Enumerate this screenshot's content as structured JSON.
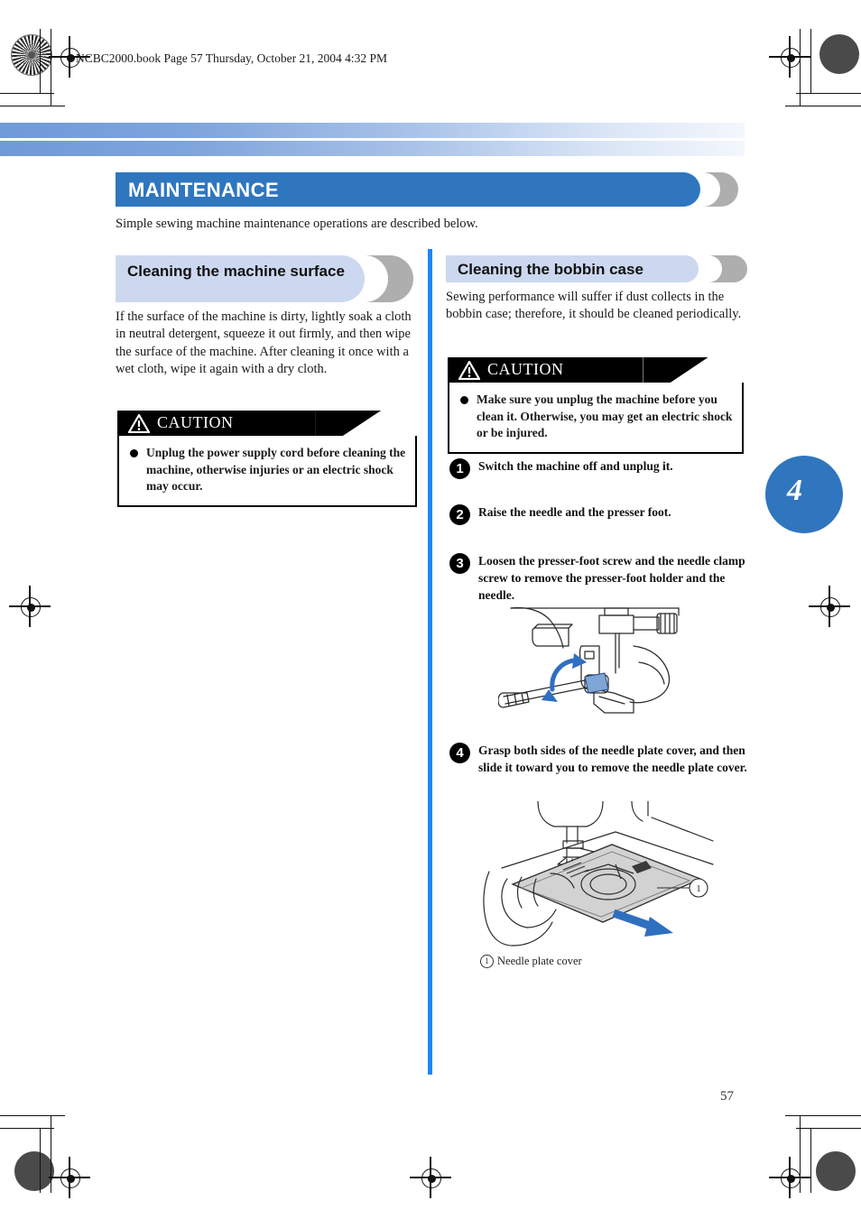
{
  "document": {
    "running_head": "NCBC2000.book  Page 57  Thursday, October 21, 2004  4:32 PM",
    "page_number": "57",
    "chapter_tab": "4"
  },
  "banner": {
    "title": "MAINTENANCE",
    "intro": "Simple sewing machine maintenance operations are described below."
  },
  "left_column": {
    "heading": "Cleaning the machine surface",
    "body": "If the surface of the machine is dirty, lightly soak a cloth in neutral detergent, squeeze it out firmly, and then wipe the surface of the machine. After cleaning it once with a wet cloth, wipe it again with a dry cloth.",
    "caution": {
      "label": "CAUTION",
      "icon": "warning-triangle-icon",
      "items": [
        "Unplug the power supply cord before cleaning the machine, otherwise injuries or an electric shock may occur."
      ]
    }
  },
  "right_column": {
    "heading": "Cleaning the bobbin case",
    "body": "Sewing performance will suffer if dust collects in the bobbin case; therefore, it should be cleaned periodically.",
    "caution": {
      "label": "CAUTION",
      "icon": "warning-triangle-icon",
      "items": [
        "Make sure you unplug the machine before you clean it. Otherwise, you may get an electric shock or be injured."
      ]
    },
    "steps": [
      {
        "number": "1",
        "text": "Switch the machine off and unplug it."
      },
      {
        "number": "2",
        "text": "Raise the needle and the presser foot."
      },
      {
        "number": "3",
        "text": "Loosen the presser-foot screw and the needle clamp screw to remove the presser-foot holder and the needle."
      },
      {
        "number": "4",
        "text": "Grasp both sides of the needle plate cover, and then slide it toward you to remove the needle plate cover."
      }
    ],
    "figures": [
      {
        "name": "presser-foot-screw-illustration",
        "caption": ""
      },
      {
        "name": "needle-plate-cover-illustration",
        "caption_number": "1",
        "caption": "Needle plate cover"
      }
    ]
  },
  "colors": {
    "banner_blue": "#2f76bf",
    "divider_blue": "#1f86f0",
    "subhead_lavender": "#ccd8ef",
    "shadow_gray": "#aeaeae",
    "arrow_blue": "#2f6fc0"
  }
}
